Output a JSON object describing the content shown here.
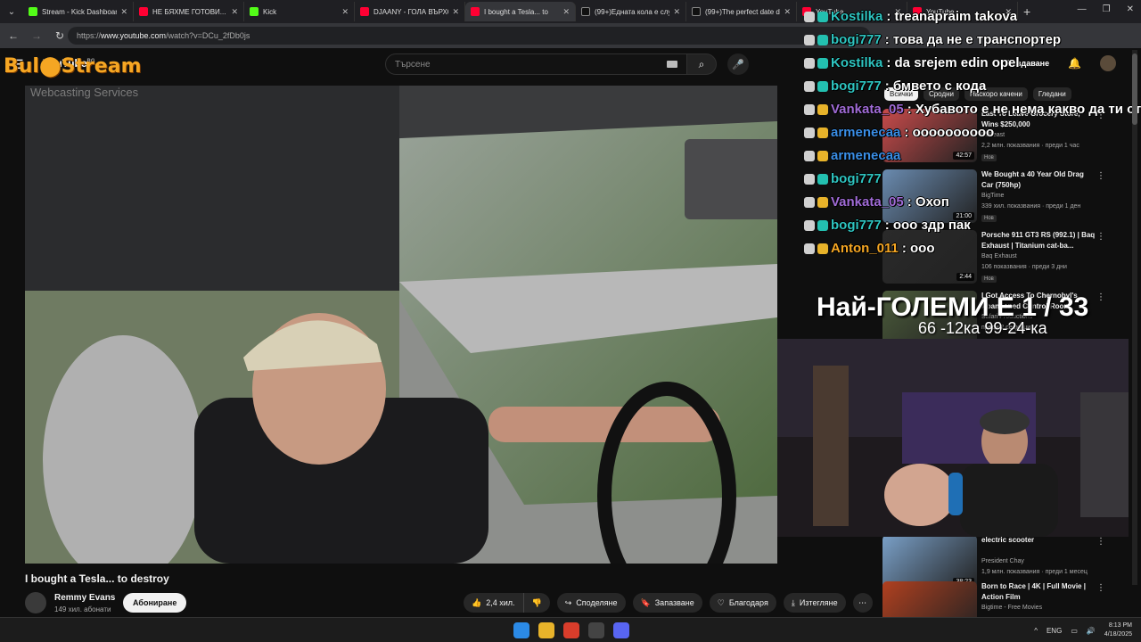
{
  "browser": {
    "tabs": [
      {
        "title": "Stream - Kick Dashboard",
        "icon": "kick",
        "active": false
      },
      {
        "title": "НЕ БЯХМЕ ГОТОВИ... не",
        "icon": "yt",
        "active": false
      },
      {
        "title": "Kick",
        "icon": "kick",
        "active": false
      },
      {
        "title": "DJAANY - ГОЛА ВЪРХО",
        "icon": "yt",
        "active": false
      },
      {
        "title": "I bought a Tesla... to",
        "icon": "yt",
        "active": true
      },
      {
        "title": "(99+)Едната кола е слу",
        "icon": "tt",
        "active": false
      },
      {
        "title": "(99+)The perfect date d",
        "icon": "tt",
        "active": false
      },
      {
        "title": "YouTube",
        "icon": "yt",
        "active": false
      },
      {
        "title": "YouTube",
        "icon": "yt",
        "active": false
      }
    ],
    "url_prefix": "https://",
    "url_host": "www.youtube.com",
    "url_path": "/watch?v=DCu_2fDb0js"
  },
  "youtube": {
    "logo": "YouTube",
    "country": "BG",
    "search_placeholder": "Търсене",
    "create_label": "Създаване"
  },
  "overlay": {
    "brand": "Bul⬤Stream",
    "brand_sub": "Webcasting Services",
    "counter_main": "Най-ГОЛЕМИ Е 1 / 33",
    "counter_sub": "66 -12ка 99-24-ка"
  },
  "video": {
    "title": "I bought a Tesla... to destroy",
    "channel": "Remmy Evans",
    "subscribers": "149 хил. абонати",
    "subscribe_label": "Абониране",
    "likes": "2,4 хил.",
    "share_label": "Споделяне",
    "save_label": "Запазване",
    "thanks_label": "Благодаря",
    "download_label": "Изтегляне"
  },
  "chips": [
    "Всички",
    "Сродни",
    "Наскоро качени",
    "Гледани"
  ],
  "recommendations": [
    {
      "title": "Last To Leave Grocery Store, Wins $250,000",
      "channel": "MrBeast",
      "meta": "2,2 млн. показвания · преди 1 час",
      "badge": "Нов",
      "duration": "42:57",
      "color": "#c94b4b"
    },
    {
      "title": "We Bought a 40 Year Old Drag Car (750hp)",
      "channel": "BigTime",
      "meta": "339 хил. показвания · преди 1 ден",
      "badge": "Нов",
      "duration": "21:00",
      "color": "#6a8bb0"
    },
    {
      "title": "Porsche 911 GT3 RS (992.1) | Baq Exhaust | Titanium cat-ba...",
      "channel": "Baq Exhaust",
      "meta": "106 показвания · преди 3 дни",
      "badge": "Нов",
      "duration": "2:44",
      "color": "#2a2a2a"
    },
    {
      "title": "I Got Access To Chernobyl's Abandoned Control Room",
      "channel": "Safari Productions",
      "meta": "преди 2 седмици",
      "badge": "",
      "duration": "",
      "color": "#4a5a3a"
    },
    {
      "title": "electric scooter",
      "channel": "President Chay",
      "meta": "1,9 млн. показвания · преди 1 месец",
      "badge": "",
      "duration": "38:23",
      "color": "#7aa0c8"
    },
    {
      "title": "Born to Race | 4K | Full Movie | Action Film",
      "channel": "Bigtime - Free Movies",
      "meta": "",
      "badge": "",
      "duration": "",
      "color": "#b04020"
    }
  ],
  "chat": [
    {
      "user": "Kostilka",
      "text": ": treanapraim takova",
      "color": "#2ec4c0",
      "badges": [
        "gray",
        "teal"
      ]
    },
    {
      "user": "bogi777",
      "text": ": това да не е транспортер",
      "color": "#2ec4c0",
      "badges": [
        "gray",
        "teal"
      ]
    },
    {
      "user": "Kostilka",
      "text": ": da srejem edin opel",
      "color": "#2ec4c0",
      "badges": [
        "gray",
        "teal"
      ]
    },
    {
      "user": "bogi777",
      "text": ": бмвето с кода",
      "color": "#2ec4c0",
      "badges": [
        "gray",
        "teal"
      ]
    },
    {
      "user": "Vankata_05",
      "text": ": Хубавото е не нема какво да ти открадн",
      "color": "#a06bd6",
      "badges": [
        "gray",
        "yel"
      ]
    },
    {
      "user": "armenecaa",
      "text": ": oooooooooo",
      "color": "#3a8ee6",
      "badges": [
        "gray",
        "yel"
      ]
    },
    {
      "user": "armenecaa",
      "text": "",
      "color": "#3a8ee6",
      "badges": [
        "gray",
        "yel"
      ]
    },
    {
      "user": "bogi777",
      "text": "",
      "color": "#2ec4c0",
      "badges": [
        "gray",
        "teal"
      ]
    },
    {
      "user": "Vankata_05",
      "text": ": Охоп",
      "color": "#a06bd6",
      "badges": [
        "gray",
        "yel"
      ]
    },
    {
      "user": "bogi777",
      "text": ": ооо здр пак",
      "color": "#2ec4c0",
      "badges": [
        "gray",
        "teal"
      ]
    },
    {
      "user": "Anton_011",
      "text": ": ооо",
      "color": "#f5a623",
      "badges": [
        "gray",
        "yel"
      ]
    }
  ],
  "taskbar": {
    "lang": "ENG",
    "time": "8:13 PM",
    "date": "4/18/2025"
  }
}
